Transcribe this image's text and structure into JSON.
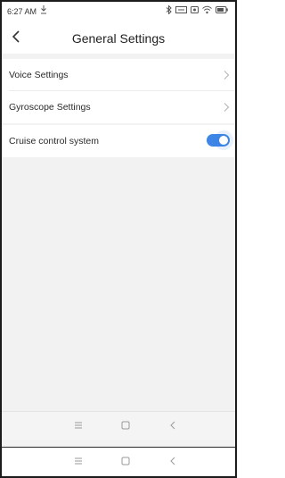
{
  "status_bar": {
    "time": "6:27 AM",
    "icons": [
      "download-icon",
      "bluetooth-icon",
      "hd-icon",
      "sim-icon",
      "wifi-icon",
      "battery-icon"
    ]
  },
  "header": {
    "title": "General Settings",
    "back_icon": "chevron-left-icon"
  },
  "settings": {
    "group1": [
      {
        "label": "Voice Settings",
        "icon": "chevron-right-icon"
      },
      {
        "label": "Gyroscope Settings",
        "icon": "chevron-right-icon"
      }
    ],
    "cruise": {
      "label": "Cruise control system",
      "enabled": true
    }
  },
  "nav_bar": {
    "buttons": [
      "menu-icon",
      "home-icon",
      "back-icon"
    ]
  },
  "colors": {
    "accent": "#3d86e6",
    "background": "#f2f2f2"
  }
}
